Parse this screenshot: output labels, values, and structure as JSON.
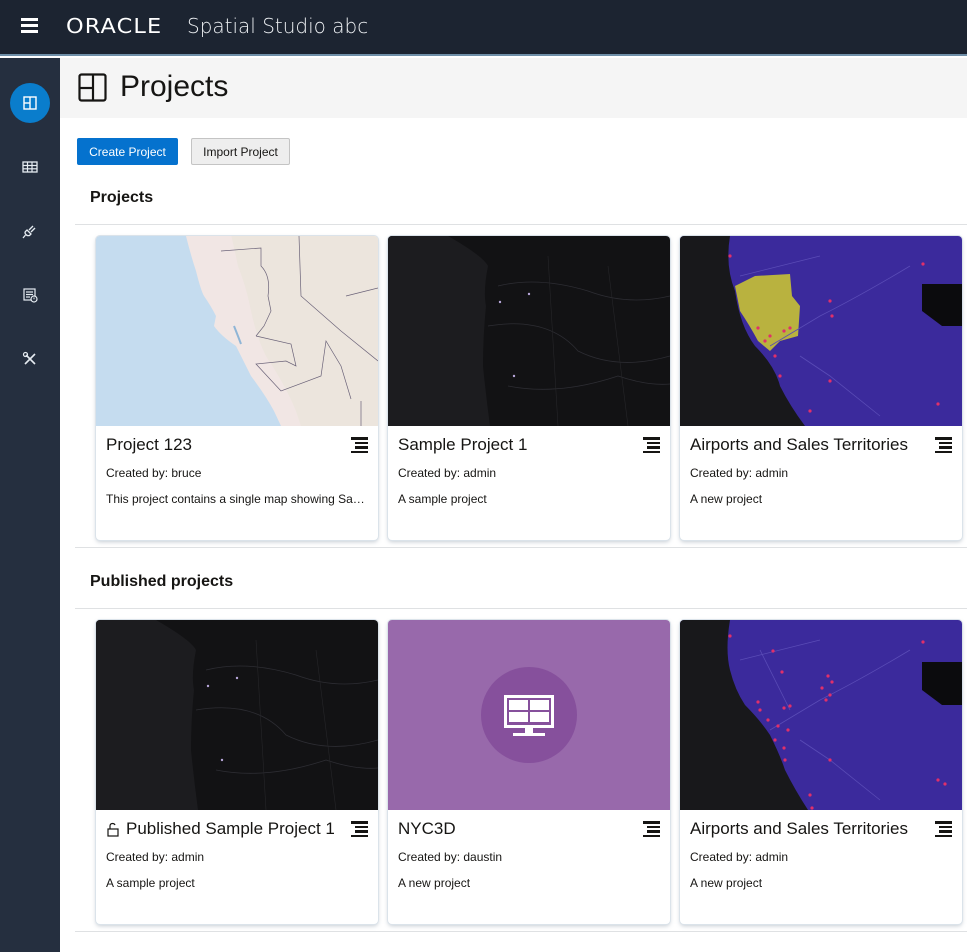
{
  "app": {
    "brand": "ORACLE",
    "product": "Spatial Studio abc"
  },
  "sidebar": {
    "items": [
      {
        "name": "projects",
        "icon": "projects-icon",
        "active": true
      },
      {
        "name": "datasets",
        "icon": "table-icon",
        "active": false
      },
      {
        "name": "connections",
        "icon": "plug-icon",
        "active": false
      },
      {
        "name": "jobs",
        "icon": "list-clock-icon",
        "active": false
      },
      {
        "name": "administration",
        "icon": "tools-icon",
        "active": false
      }
    ]
  },
  "header": {
    "title": "Projects",
    "icon": "projects-icon"
  },
  "toolbar": {
    "create_label": "Create Project",
    "import_label": "Import Project"
  },
  "sections": {
    "projects": {
      "title": "Projects",
      "cards": [
        {
          "title": "Project 123",
          "creator": "Created by: bruce",
          "description": "This project contains a single map showing San Francisco Bay Area counties",
          "thumbnail": "light-basemap",
          "published": false
        },
        {
          "title": "Sample Project 1",
          "creator": "Created by: admin",
          "description": "A sample project",
          "thumbnail": "dark-basemap",
          "published": false
        },
        {
          "title": "Airports and Sales Territories",
          "creator": "Created by: admin",
          "description": "A new project",
          "thumbnail": "purple-territories-map",
          "published": false
        }
      ]
    },
    "published": {
      "title": "Published projects",
      "cards": [
        {
          "title": "Published Sample Project 1",
          "creator": "Created by: admin",
          "description": "A sample project",
          "thumbnail": "dark-basemap",
          "published": true
        },
        {
          "title": "NYC3D",
          "creator": "Created by: daustin",
          "description": "A new project",
          "thumbnail": "monitor-placeholder",
          "published": false
        },
        {
          "title": "Airports and Sales Territories",
          "creator": "Created by: admin",
          "description": "A new project",
          "thumbnail": "purple-airports-map",
          "published": false
        }
      ]
    }
  },
  "colors": {
    "topbar": "#1c2431",
    "sidebar": "#252f3f",
    "accent": "#0572ce",
    "placeholder_bg": "#9869ab",
    "placeholder_circle": "#86509c",
    "territory_bg": "#3a2a9a",
    "territory_highlight": "#b9b23f"
  }
}
